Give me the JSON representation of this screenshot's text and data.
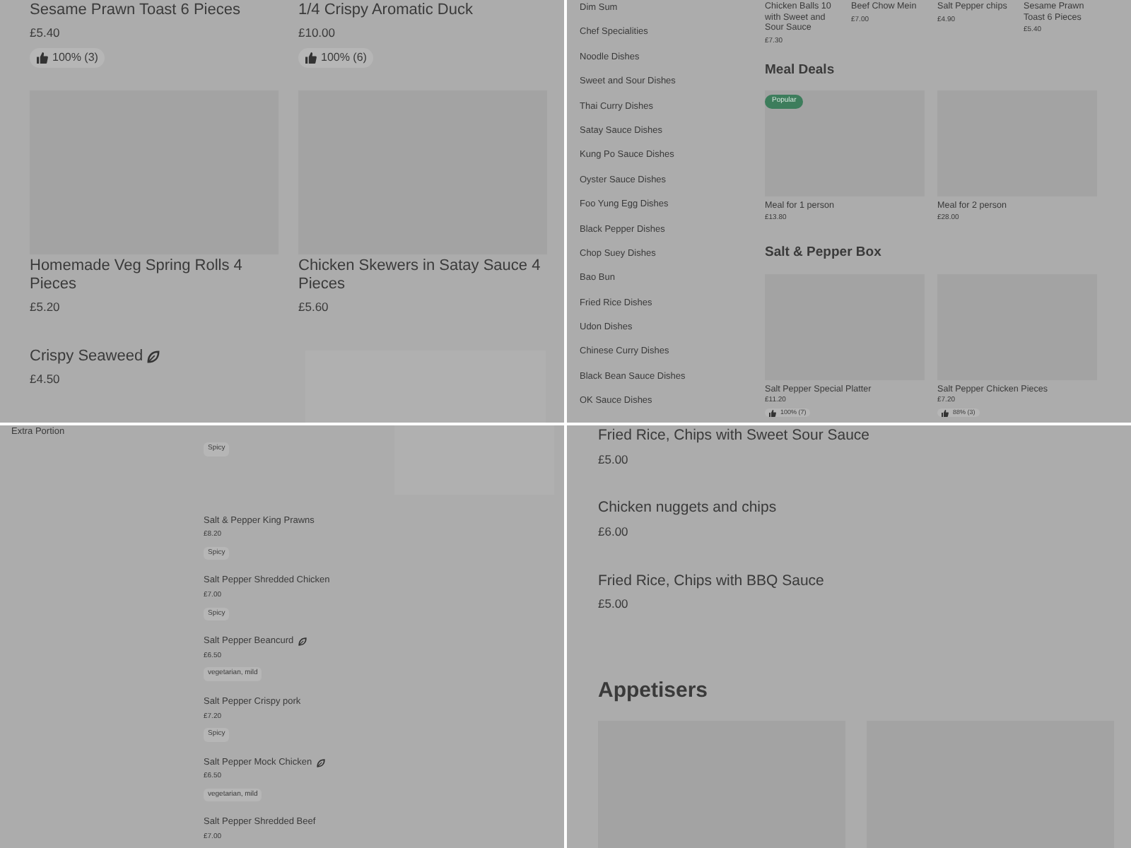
{
  "top_left": {
    "items": [
      {
        "name": "Sesame Prawn Toast 6 Pieces",
        "price": "£5.40",
        "rating": "100% (3)"
      },
      {
        "name": "1/4 Crispy Aromatic Duck",
        "price": "£10.00",
        "rating": "100% (6)"
      },
      {
        "name": "Homemade Veg Spring Rolls 4 Pieces",
        "price": "£5.20",
        "has_image": true
      },
      {
        "name": "Chicken Skewers in Satay Sauce 4 Pieces",
        "price": "£5.60",
        "has_image": true
      },
      {
        "name": "Crispy Seaweed",
        "price": "£4.50",
        "vegetarian": true
      },
      {
        "has_image": true
      }
    ]
  },
  "top_right": {
    "categories": [
      "Dim Sum",
      "Chef Specialities",
      "Noodle Dishes",
      "Sweet and Sour Dishes",
      "Thai Curry Dishes",
      "Satay Sauce Dishes",
      "Kung Po Sauce Dishes",
      "Oyster Sauce Dishes",
      "Foo Yung Egg Dishes",
      "Black Pepper Dishes",
      "Chop Suey Dishes",
      "Bao Bun",
      "Fried Rice Dishes",
      "Udon Dishes",
      "Chinese Curry Dishes",
      "Black Bean Sauce Dishes",
      "OK Sauce Dishes"
    ],
    "top_items": [
      {
        "name": "Chicken Balls 10 with Sweet and Sour Sauce",
        "price": "£7.30"
      },
      {
        "name": "Beef Chow Mein",
        "price": "£7.00"
      },
      {
        "name": "Salt Pepper chips",
        "price": "£4.90"
      },
      {
        "name": "Sesame Prawn Toast 6 Pieces",
        "price": "£5.40"
      }
    ],
    "sections": [
      {
        "title": "Meal Deals",
        "items": [
          {
            "name": "Meal for 1 person",
            "price": "£13.80",
            "badge": "Popular"
          },
          {
            "name": "Meal for 2 person",
            "price": "£28.00"
          }
        ]
      },
      {
        "title": "Salt & Pepper Box",
        "items": [
          {
            "name": "Salt Pepper Special Platter",
            "price": "£11.20",
            "rating": "100% (7)"
          },
          {
            "name": "Salt Pepper Chicken Pieces",
            "price": "£7.20",
            "rating": "88% (3)"
          }
        ]
      }
    ]
  },
  "bottom_left": {
    "categories": [
      "Extra Portion"
    ],
    "items": [
      {
        "tags": "Spicy"
      },
      {
        "name": "Salt & Pepper King Prawns",
        "price": "£8.20",
        "tags": "Spicy"
      },
      {
        "name": "Salt Pepper Shredded Chicken",
        "price": "£7.00",
        "tags": "Spicy"
      },
      {
        "name": "Salt Pepper Beancurd",
        "price": "£6.50",
        "tags": "vegetarian, mild",
        "vegetarian": true
      },
      {
        "name": "Salt Pepper Crispy pork",
        "price": "£7.20",
        "tags": "Spicy"
      },
      {
        "name": "Salt Pepper Mock Chicken",
        "price": "£6.50",
        "tags": "vegetarian, mild",
        "vegetarian": true
      },
      {
        "name": "Salt Pepper Shredded Beef",
        "price": "£7.00"
      }
    ]
  },
  "bottom_right": {
    "items": [
      {
        "name": "Fried Rice, Chips with Sweet Sour Sauce",
        "price": "£5.00"
      },
      {
        "name": "Chicken nuggets and chips",
        "price": "£6.00"
      },
      {
        "name": "Fried Rice, Chips with BBQ Sauce",
        "price": "£5.00"
      }
    ],
    "section_title": "Appetisers"
  }
}
